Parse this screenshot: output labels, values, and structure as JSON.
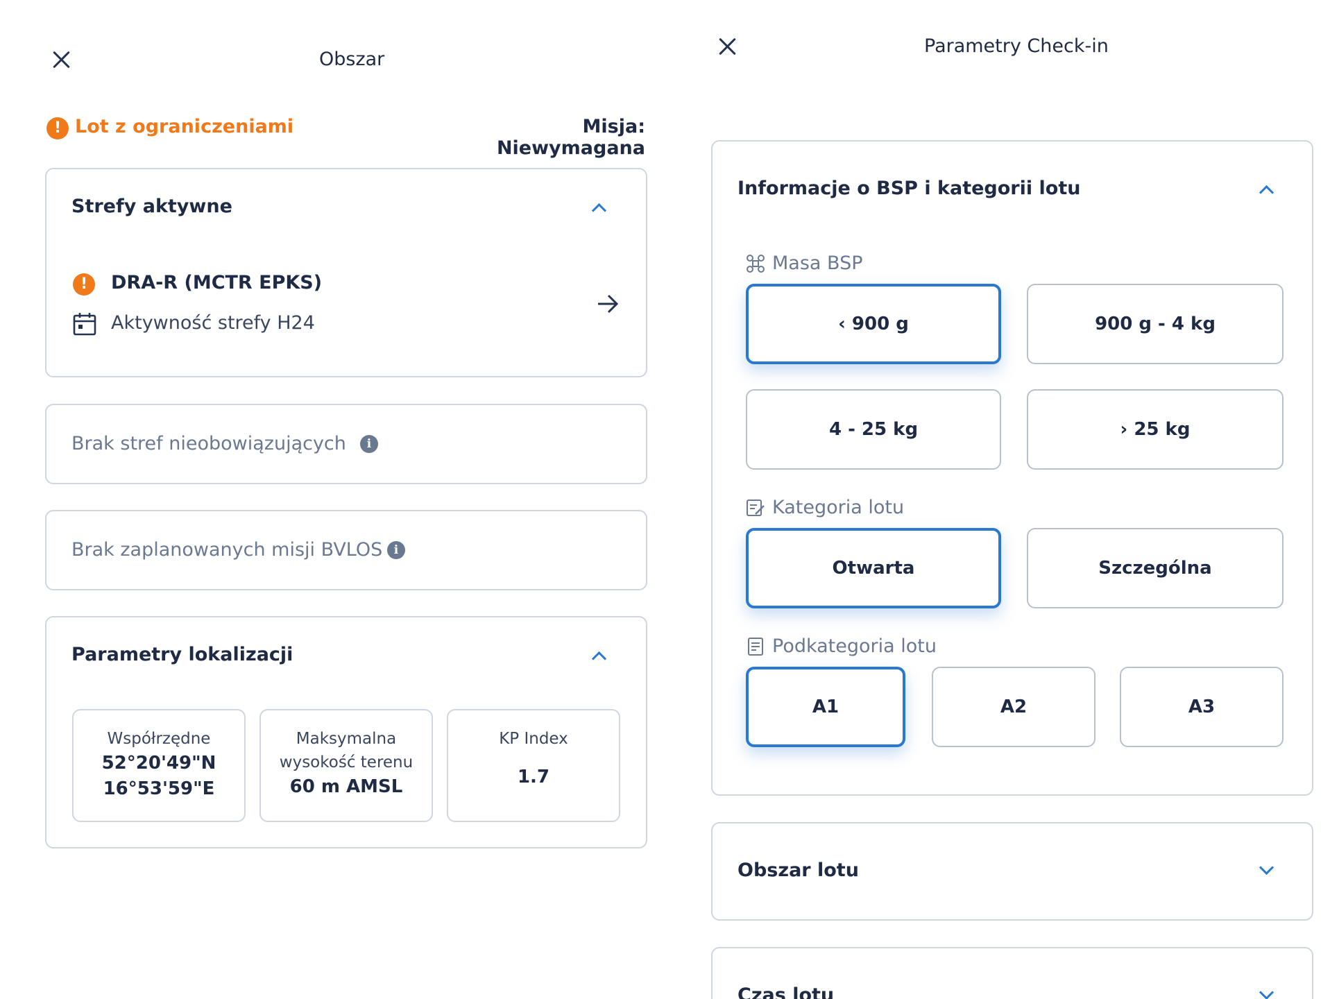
{
  "left": {
    "title": "Obszar",
    "status": {
      "text": "Lot z ograniczeniami",
      "color": "#f07a1a"
    },
    "mission": "Misja: Niewymagana",
    "zones": {
      "header": "Strefy aktywne",
      "item": {
        "name": "DRA-R (MCTR EPKS)",
        "activity": "Aktywność strefy H24"
      }
    },
    "no_zones": "Brak stref nieobowiązujących",
    "no_bvlos": "Brak zaplanowanych misji BVLOS",
    "location": {
      "header": "Parametry lokalizacji",
      "coords": {
        "label": "Współrzędne",
        "lat": "52°20'49\"N",
        "lon": "16°53'59\"E"
      },
      "max_height": {
        "label_1": "Maksymalna",
        "label_2": "wysokość terenu",
        "value": "60 m AMSL"
      },
      "kp": {
        "label": "KP Index",
        "value": "1.7"
      }
    }
  },
  "right": {
    "title": "Parametry Check-in",
    "bsp": {
      "header": "Informacje o BSP i kategorii lotu",
      "mass_label": "Masa BSP",
      "mass_options": [
        "‹ 900 g",
        "900 g - 4 kg",
        "4 - 25 kg",
        "› 25 kg"
      ],
      "category_label": "Kategoria lotu",
      "category_options": [
        "Otwarta",
        "Szczególna"
      ],
      "subcategory_label": "Podkategoria lotu",
      "subcategory_options": [
        "A1",
        "A2",
        "A3"
      ]
    },
    "area_header": "Obszar lotu",
    "time_header": "Czas lotu"
  },
  "colors": {
    "accent": "#2a79d1",
    "warning": "#f07a1a",
    "text": "#1f2a44",
    "muted": "#6b7891"
  }
}
